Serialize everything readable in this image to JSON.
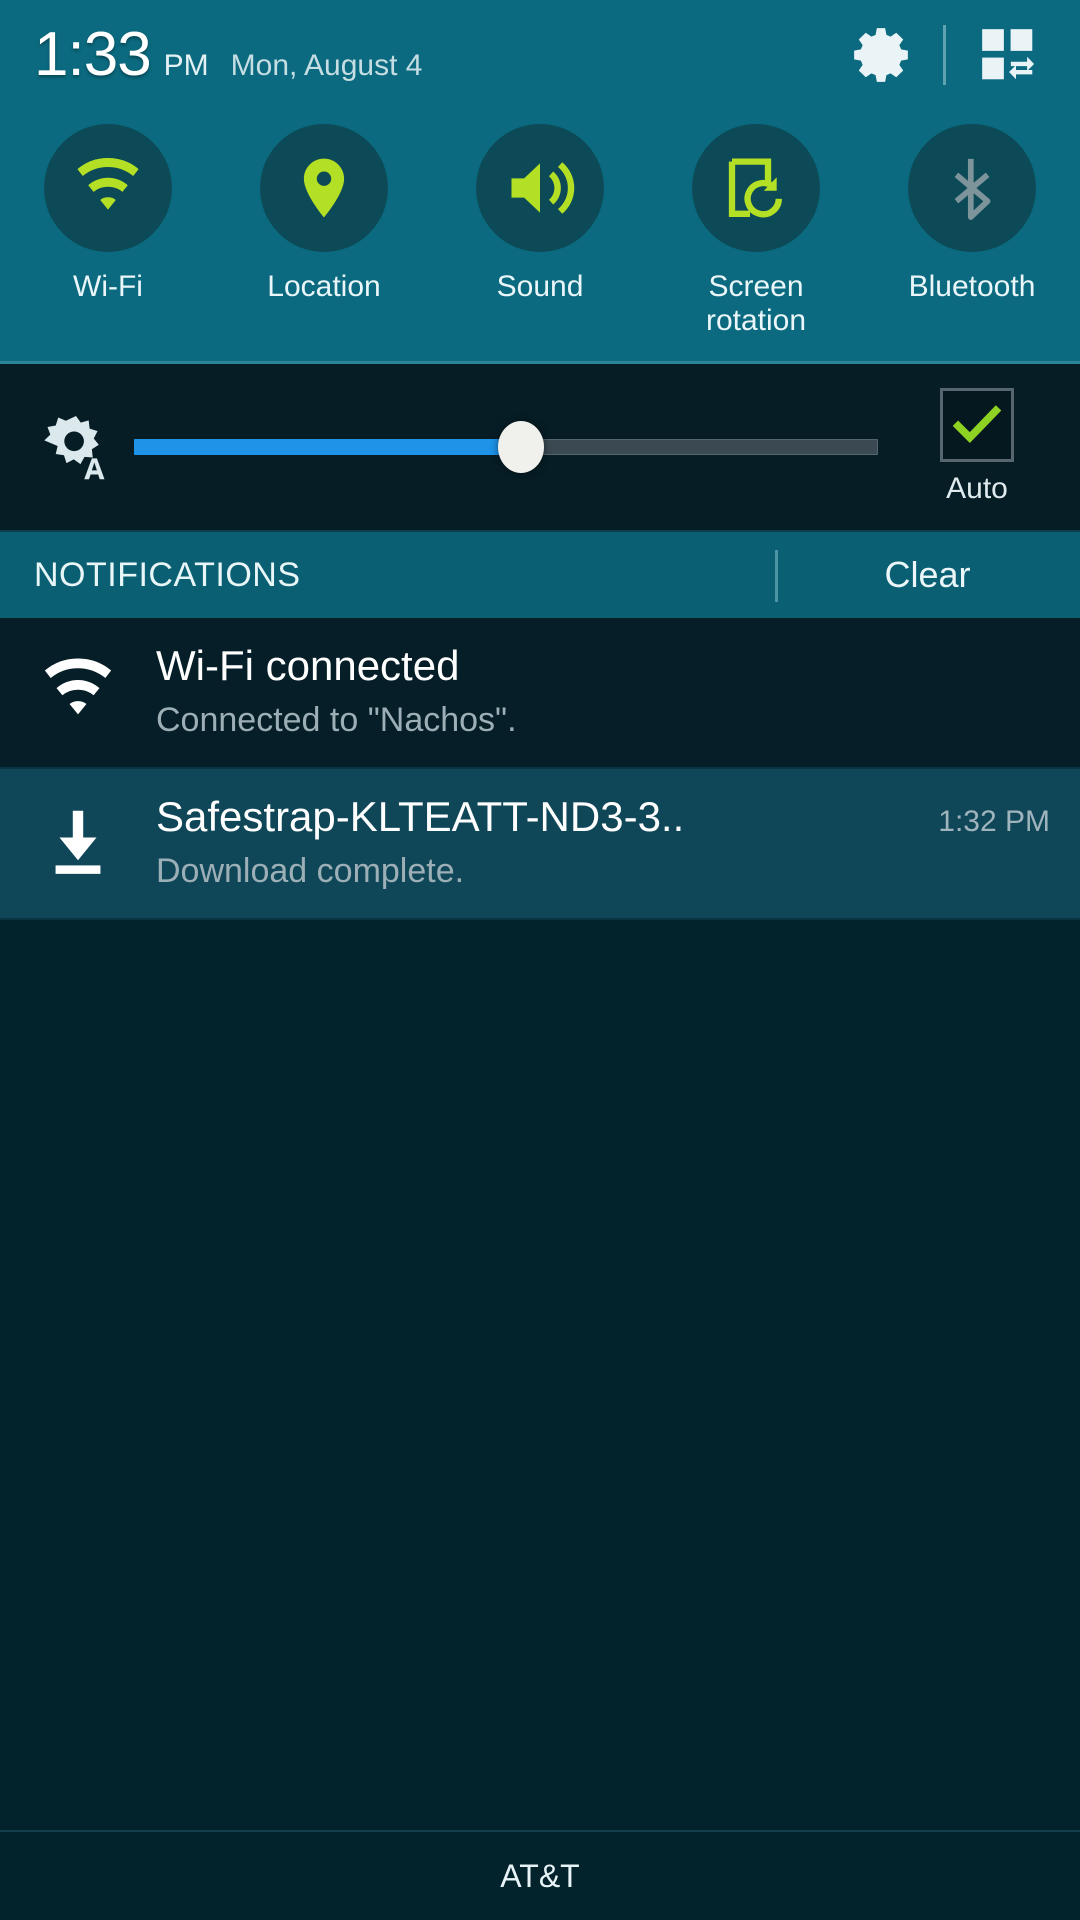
{
  "status_bar": {
    "time": "1:33",
    "ampm": "PM",
    "date": "Mon, August 4",
    "settings_icon": "gear-icon",
    "quick_settings_icon": "quick-settings-grid-icon"
  },
  "quick_toggles": [
    {
      "label": "Wi-Fi",
      "icon": "wifi-icon",
      "state": "on",
      "color": "#b3e024"
    },
    {
      "label": "Location",
      "icon": "location-pin-icon",
      "state": "on",
      "color": "#b3e024"
    },
    {
      "label": "Sound",
      "icon": "speaker-sound-icon",
      "state": "on",
      "color": "#b3e024"
    },
    {
      "label": "Screen\nrotation",
      "icon": "screen-rotation-icon",
      "state": "on",
      "color": "#b3e024"
    },
    {
      "label": "Bluetooth",
      "icon": "bluetooth-icon",
      "state": "off",
      "color": "#7d949b"
    }
  ],
  "brightness": {
    "icon": "auto-brightness-icon",
    "value_percent": 52,
    "fill_color": "#1e93e8",
    "auto_label": "Auto",
    "auto_checked": true,
    "check_color": "#8ed323"
  },
  "notifications_header": {
    "title": "NOTIFICATIONS",
    "clear_label": "Clear"
  },
  "notifications": [
    {
      "icon": "wifi-icon",
      "title": "Wi-Fi connected",
      "subtitle": "Connected to \"Nachos\".",
      "time": "",
      "theme": "dark"
    },
    {
      "icon": "download-icon",
      "title": "Safestrap-KLTEATT-ND3-3..",
      "subtitle": "Download complete.",
      "time": "1:32 PM",
      "theme": "light"
    }
  ],
  "carrier": {
    "name": "AT&T"
  },
  "colors": {
    "header_teal": "#0b6a7f",
    "toggle_circle": "#0d4a57",
    "accent_lime": "#b3e024",
    "panel_dark": "#02222c"
  }
}
